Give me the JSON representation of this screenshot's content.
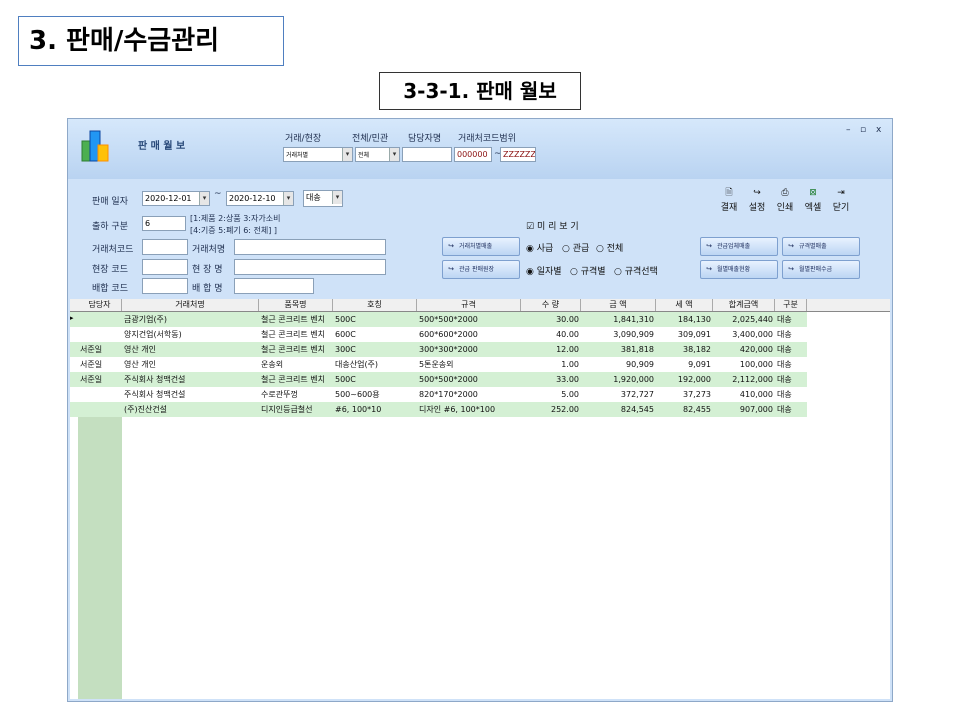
{
  "slide_title": "3. 판매/수금관리",
  "sub_title": "3-3-1. 판매 월보",
  "window": {
    "title": "판 매 월 보",
    "controls": [
      "–",
      "▫",
      "x"
    ],
    "header_labels": {
      "partner_site": "거래/현장",
      "all_gov": "전체/민관",
      "manager": "담당자명",
      "code_range": "거래처코드범위"
    },
    "partner_site_value": "거래처별",
    "all_gov_value": "전체",
    "manager_value": "",
    "code_from": "000000",
    "code_to": "ZZZZZZ",
    "code_sep": "~"
  },
  "filters": {
    "sale_date_label": "판매 일자",
    "date_from": "2020-12-01",
    "date_sep": "~",
    "date_to": "2020-12-10",
    "unit_select": "대송",
    "ship_type_label": "출하 구분",
    "ship_type_value": "6",
    "ship_hint_1": "[1:제품 2:상품 3:자가소비",
    "ship_hint_2": "[4:기증 5:폐기 6: 전체] ]",
    "partner_code_label": "거래처코드",
    "partner_name_label": "거래처명",
    "site_code_label": "현장 코드",
    "site_name_label": "현 장 명",
    "mix_code_label": "배합 코드",
    "mix_name_label": "배 합 명",
    "preview_label": "미 리 보 기",
    "radio_row1": [
      "사급",
      "관급",
      "전체"
    ],
    "radio_row2": [
      "일자별",
      "규격별",
      "규격선택"
    ]
  },
  "buttons": {
    "btn1": "거래처별매출",
    "btn2": "관급 판매원장",
    "btn3": "관급업체매출",
    "btn4": "규격별매출",
    "btn5": "월별매출현황",
    "btn6": "월별판매수금"
  },
  "toolbar": [
    {
      "label": "결재",
      "icon": "approve-icon"
    },
    {
      "label": "설정",
      "icon": "settings-icon"
    },
    {
      "label": "인쇄",
      "icon": "print-icon"
    },
    {
      "label": "엑셀",
      "icon": "excel-icon"
    },
    {
      "label": "닫기",
      "icon": "exit-icon"
    }
  ],
  "grid": {
    "columns": [
      "담당자",
      "거래처명",
      "품목명",
      "호칭",
      "규격",
      "수 량",
      "금 액",
      "세 액",
      "합계금액",
      "구분"
    ],
    "rows": [
      [
        "",
        "금광기업(주)",
        "철근 콘크리트 벤치",
        "500C",
        "500*500*2000",
        "30.00",
        "1,841,310",
        "184,130",
        "2,025,440",
        "대송"
      ],
      [
        "",
        "양지건업(서학동)",
        "철근 콘크리트 벤치",
        "600C",
        "600*600*2000",
        "40.00",
        "3,090,909",
        "309,091",
        "3,400,000",
        "대송"
      ],
      [
        "서준일",
        "영산 개인",
        "철근 콘크리트 벤치",
        "300C",
        "300*300*2000",
        "12.00",
        "381,818",
        "38,182",
        "420,000",
        "대송"
      ],
      [
        "서준일",
        "영산 개인",
        "운송외",
        "대송산업(주)",
        "5톤운송외",
        "1.00",
        "90,909",
        "9,091",
        "100,000",
        "대송"
      ],
      [
        "서준일",
        "주식회사 청맥건설",
        "철근 콘크리트 벤치",
        "500C",
        "500*500*2000",
        "33.00",
        "1,920,000",
        "192,000",
        "2,112,000",
        "대송"
      ],
      [
        "",
        "주식회사 청맥건설",
        "수로관뚜껑",
        "500~600용",
        "820*170*2000",
        "5.00",
        "372,727",
        "37,273",
        "410,000",
        "대송"
      ],
      [
        "",
        "(주)진산건설",
        "디지인등급철선",
        "#6, 100*10",
        "디자인 #6, 100*100",
        "252.00",
        "824,545",
        "82,455",
        "907,000",
        "대송"
      ]
    ]
  }
}
